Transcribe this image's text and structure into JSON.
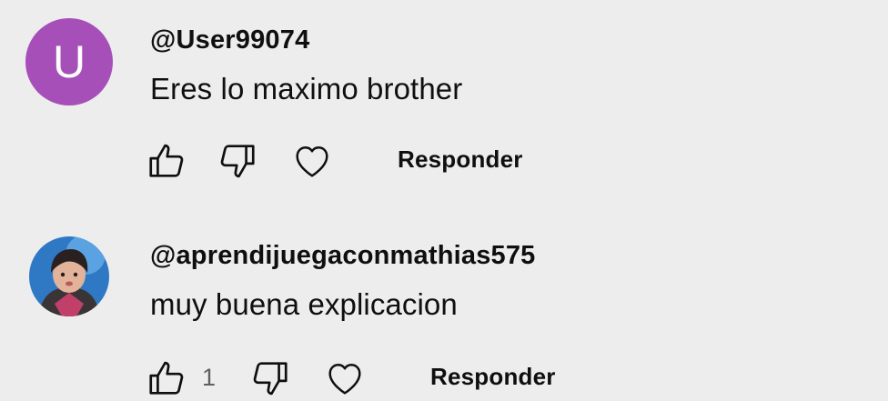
{
  "comments": [
    {
      "avatar_letter": "U",
      "avatar_color": "#a64fb8",
      "author": "@User99074",
      "text": "Eres lo maximo brother",
      "like_count": "",
      "reply_label": "Responder"
    },
    {
      "avatar_letter": "",
      "author": "@aprendijuegaconmathias575",
      "text": "muy buena explicacion",
      "like_count": "1",
      "reply_label": "Responder"
    }
  ],
  "icons": {
    "like": "thumbs-up-icon",
    "dislike": "thumbs-down-icon",
    "heart": "heart-icon"
  }
}
